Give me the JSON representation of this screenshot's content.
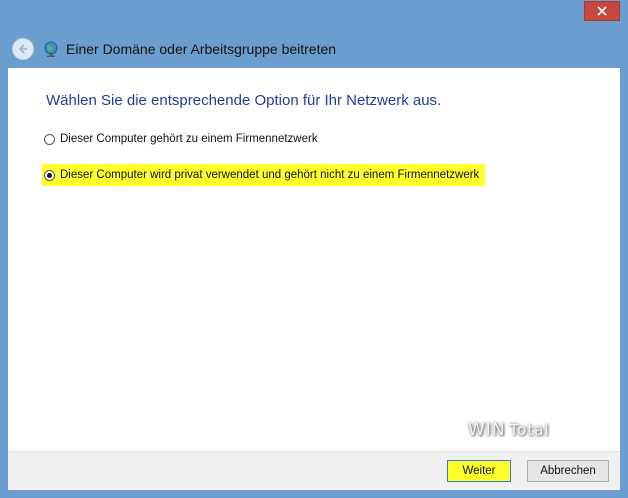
{
  "window": {
    "title": "Einer Domäne oder Arbeitsgruppe beitreten"
  },
  "heading": "Wählen Sie die entsprechende Option für Ihr Netzwerk aus.",
  "options": [
    {
      "label": "Dieser Computer gehört zu einem Firmennetzwerk",
      "selected": false
    },
    {
      "label": "Dieser Computer wird privat verwendet und gehört nicht zu einem Firmennetzwerk",
      "selected": true,
      "highlighted": true
    }
  ],
  "buttons": {
    "next": "Weiter",
    "cancel": "Abbrechen"
  },
  "watermark": {
    "part1": "WIN",
    "part2": "Total"
  },
  "icons": {
    "close": "close-icon",
    "back": "back-arrow-icon",
    "network": "network-globe-icon"
  },
  "colors": {
    "frame": "#6b9ecf",
    "heading": "#1e3f9c",
    "highlight": "#ffff2a",
    "close": "#c7463d"
  }
}
